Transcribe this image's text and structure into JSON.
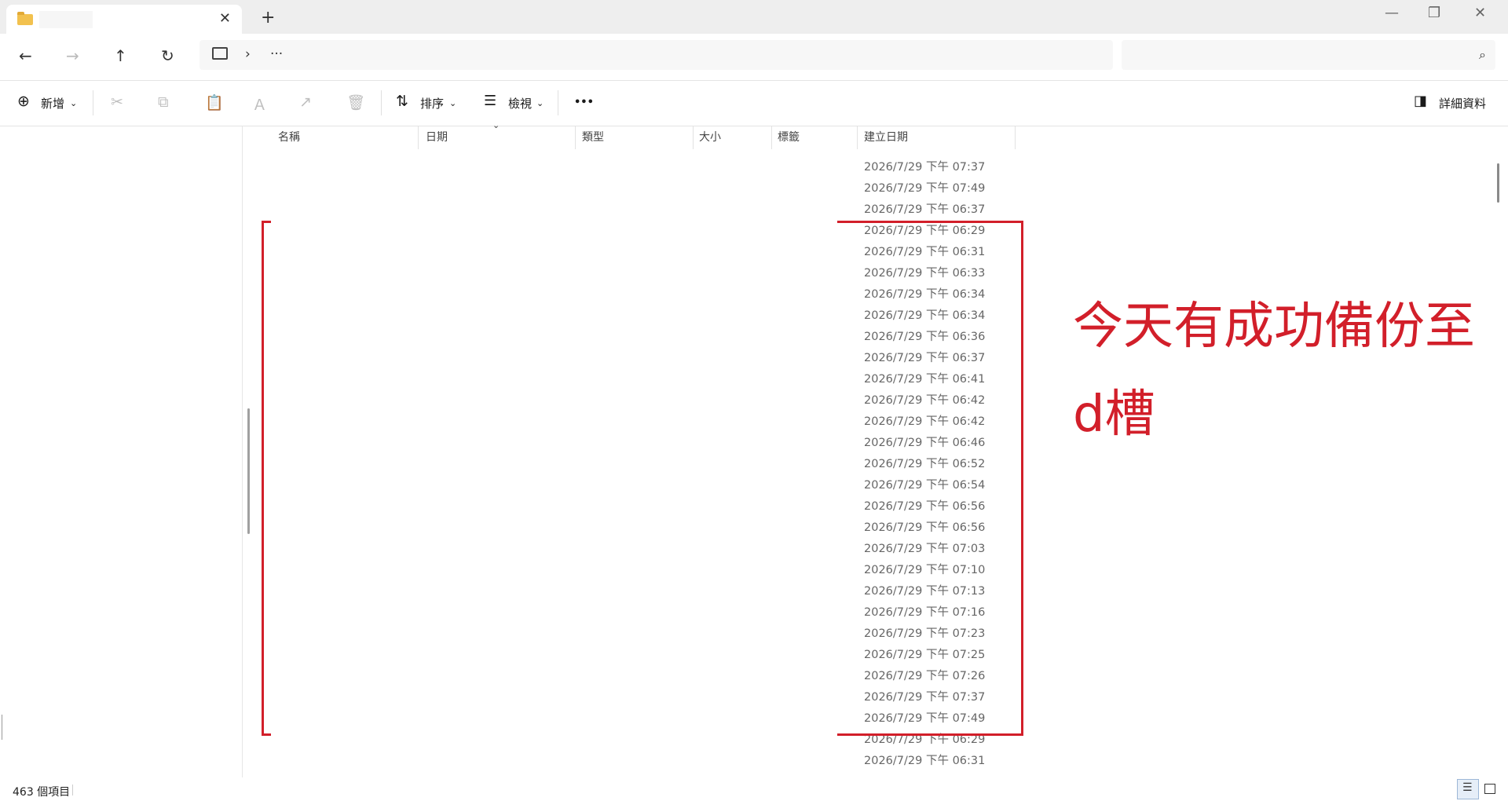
{
  "titlebar": {
    "tab_title": "",
    "close": "✕",
    "new_tab": "+"
  },
  "window_controls": {
    "minimize": "—",
    "maximize": "❐",
    "close": "✕"
  },
  "navbar": {
    "back": "←",
    "forward": "→",
    "up": "↑",
    "refresh": "↻",
    "address_chevron": "›",
    "address_overflow": "···",
    "search_placeholder": "",
    "search_icon": "⌕"
  },
  "commandbar": {
    "new_label": "新增",
    "new_icon": "⊕",
    "chevron": "⌄",
    "cut": "✂",
    "copy": "⧉",
    "paste": "📋",
    "rename": "Ａ",
    "share": "↗",
    "delete": "🗑",
    "sort_label": "排序",
    "sort_icon": "⇅",
    "view_label": "檢視",
    "view_icon": "☰",
    "more": "•••",
    "details_label": "詳細資料",
    "details_icon": "◨"
  },
  "columns": {
    "name": "名稱",
    "date": "日期",
    "type": "類型",
    "size": "大小",
    "tags": "標籤",
    "created": "建立日期"
  },
  "rows": [
    "2026/7/29 下午 07:37",
    "2026/7/29 下午 07:49",
    "2026/7/29 下午 06:37",
    "2026/7/29 下午 06:29",
    "2026/7/29 下午 06:31",
    "2026/7/29 下午 06:33",
    "2026/7/29 下午 06:34",
    "2026/7/29 下午 06:34",
    "2026/7/29 下午 06:36",
    "2026/7/29 下午 06:37",
    "2026/7/29 下午 06:41",
    "2026/7/29 下午 06:42",
    "2026/7/29 下午 06:42",
    "2026/7/29 下午 06:46",
    "2026/7/29 下午 06:52",
    "2026/7/29 下午 06:54",
    "2026/7/29 下午 06:56",
    "2026/7/29 下午 06:56",
    "2026/7/29 下午 07:03",
    "2026/7/29 下午 07:10",
    "2026/7/29 下午 07:13",
    "2026/7/29 下午 07:16",
    "2026/7/29 下午 07:23",
    "2026/7/29 下午 07:25",
    "2026/7/29 下午 07:26",
    "2026/7/29 下午 07:37",
    "2026/7/29 下午 07:49",
    "2026/7/29 下午 06:29",
    "2026/7/29 下午 06:31"
  ],
  "annotation": {
    "line1": "今天有成功備份至",
    "line2": "d槽",
    "color": "#d21f2a"
  },
  "statusbar": {
    "item_count": "463 個項目"
  }
}
